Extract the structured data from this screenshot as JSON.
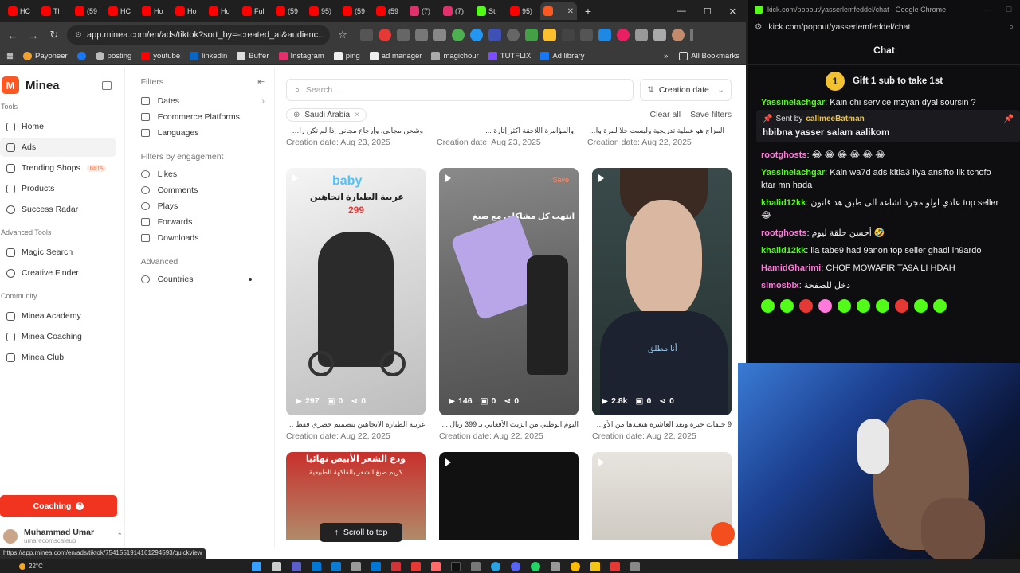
{
  "browser": {
    "tabs": [
      {
        "label": "HC",
        "color": "#ff0000"
      },
      {
        "label": "Th",
        "color": "#ff0000"
      },
      {
        "label": "(59",
        "color": "#ff0000"
      },
      {
        "label": "HC",
        "color": "#ff0000"
      },
      {
        "label": "Ho",
        "color": "#ff0000"
      },
      {
        "label": "Ho",
        "color": "#ff0000"
      },
      {
        "label": "Ho",
        "color": "#ff0000"
      },
      {
        "label": "Ful",
        "color": "#ff0000"
      },
      {
        "label": "(59",
        "color": "#ff0000"
      },
      {
        "label": "95)",
        "color": "#ff0000"
      },
      {
        "label": "(59",
        "color": "#ff0000"
      },
      {
        "label": "(59",
        "color": "#ff0000"
      },
      {
        "label": "(7)",
        "color": "#e1306c"
      },
      {
        "label": "(7)",
        "color": "#e1306c"
      },
      {
        "label": "Str",
        "color": "#53fc18"
      },
      {
        "label": "95)",
        "color": "#ff0000"
      }
    ],
    "active_tab_close": "✕",
    "new_tab": "+",
    "url": "app.minea.com/en/ads/tiktok?sort_by=-created_at&audienc...",
    "bookmarks": [
      "Payoneer",
      "posting",
      "youtube",
      "linkedin",
      "Buffer",
      "Instagram",
      "ping",
      "ad manager",
      "magichour",
      "TUTFLIX",
      "Ad library"
    ],
    "bookmarks_more": "»",
    "all_bookmarks": "All Bookmarks",
    "status_url": "https://app.minea.com/en/ads/tiktok/7541551914161294593/quickview"
  },
  "sidebar": {
    "brand": "Minea",
    "sections": {
      "tools": "Tools",
      "advanced_tools": "Advanced Tools",
      "community": "Community"
    },
    "tools": [
      "Home",
      "Ads",
      "Trending Shops",
      "Products",
      "Success Radar"
    ],
    "beta": "BETA",
    "advanced": [
      "Magic Search",
      "Creative Finder"
    ],
    "community": [
      "Minea Academy",
      "Minea Coaching",
      "Minea Club"
    ],
    "coaching_button": "Coaching",
    "user_name": "Muhammad Umar",
    "user_sub": "umarecomscaleup"
  },
  "filters": {
    "title": "Filters",
    "items": [
      "Dates",
      "Ecommerce Platforms",
      "Languages"
    ],
    "engagement_title": "Filters by engagement",
    "engagement": [
      "Likes",
      "Comments",
      "Plays",
      "Forwards",
      "Downloads"
    ],
    "advanced_title": "Advanced",
    "advanced": [
      "Countries"
    ]
  },
  "content": {
    "search_placeholder": "Search...",
    "sort_label": "Creation date",
    "chip": "Saudi Arabia",
    "clear_all": "Clear all",
    "save_filters": "Save filters",
    "prev_row": [
      {
        "desc": "وشحن مجاني، وإرجاع مجاني إذا لم تكن راضيًا ...",
        "date": "Creation date: Aug 23, 2025"
      },
      {
        "desc": "والمؤامرة اللاحقة أكثر إثارة ...",
        "date": "Creation date: Aug 23, 2025"
      },
      {
        "desc": "المزاج هو عملية تدريجية وليست حلًا لمرة واحدة ...",
        "date": "Creation date: Aug 22, 2025"
      }
    ],
    "cards": [
      {
        "plays": "297",
        "comments": "0",
        "shares": "0",
        "desc": "عربية الطيارة الاتجاهين بتصميم حصري فقط ب 299 ريال ...",
        "date": "Creation date: Aug 22, 2025",
        "overlay_1": "baby",
        "overlay_2": "عربية الطيارة اتجاهين",
        "overlay_3": "299"
      },
      {
        "plays": "146",
        "comments": "0",
        "shares": "0",
        "desc": "اليوم الوطني من الزيت الأفغاني بـ 399 ريال ...",
        "date": "Creation date: Aug 22, 2025",
        "overlay_1": "انتهت كل مشاكلي مع صبغ",
        "save": "Save"
      },
      {
        "plays": "2.8k",
        "comments": "0",
        "shares": "0",
        "desc": "9 حلقات حيرة ويعد العاشرة هتعيدها من الأول ...",
        "date": "Creation date: Aug 22, 2025",
        "overlay_1": "أنا مطلق"
      }
    ],
    "row3_overlay": "ودع الشعر الأبيض نهائيا",
    "row3_overlay_sub": "كريم صبغ الشعر بالفاكهة الطبيعية",
    "scroll_top": "Scroll to top"
  },
  "chat": {
    "title_bar": "kick.com/popout/yasserlemfeddel/chat - Google Chrome",
    "url": "kick.com/popout/yasserlemfeddel/chat",
    "header": "Chat",
    "gift_count": "1",
    "gift_text": "Gift 1 sub to take 1st",
    "top_msg_user": "Yassinelachgar",
    "top_msg_text": "Kain chi service mzyan dyal soursin ?",
    "pinned_sent_by": "Sent by",
    "pinned_user": "callmeeBatman",
    "pinned_text": "hbibna yasser salam aalikom",
    "messages": [
      {
        "user": "rootghosts",
        "color": "#ff7ad9",
        "text": "😂 😂 😂 😂 😂 😂"
      },
      {
        "user": "Yassinelachgar",
        "color": "#53fc18",
        "text": "Kain wa7d ads kitla3 liya ansifto lik tchofo ktar mn hada"
      },
      {
        "user": "khalid12kk",
        "color": "#53fc18",
        "text": "عادي اولو مجرد اشاعة الى طبق هد قانون top seller 😂"
      },
      {
        "user": "rootghosts",
        "color": "#ff7ad9",
        "text": "أحسن حلقة ليوم 🤣"
      },
      {
        "user": "khalid12kk",
        "color": "#53fc18",
        "text": "ila tabe9 had 9anon top seller ghadi in9ardo"
      },
      {
        "user": "HamidGharimi",
        "color": "#ff7ad9",
        "text": "CHOF MOWAFIR TA9A LI HDAH"
      },
      {
        "user": "simosbix",
        "color": "#ff7ad9",
        "text": "دخل للصفحة"
      }
    ]
  },
  "taskbar": {
    "temp": "22°C"
  }
}
